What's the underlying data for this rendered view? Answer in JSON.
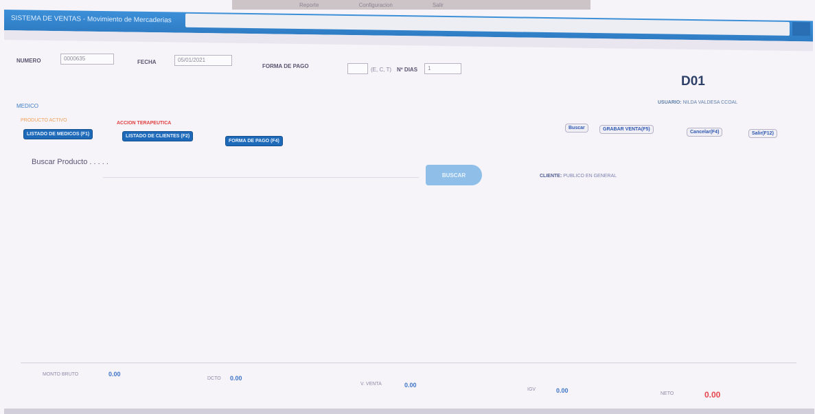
{
  "top_menu": [
    "",
    "Reporte",
    "Configuracion",
    "Salir"
  ],
  "window": {
    "title": "SISTEMA DE VENTAS - Movimiento de Mercaderias"
  },
  "form": {
    "numero_label": "NUMERO",
    "numero_value": "0000635",
    "fecha_label": "FECHA",
    "fecha_value": "05/01/2021",
    "forma_pago_label": "FORMA DE PAGO",
    "forma_pago_hint": "(E, C, T)",
    "dias_label": "Nº DIAS",
    "dias_value": "1"
  },
  "header": {
    "code": "D01",
    "usuario_label": "USUARIO:",
    "usuario_value": "NILDA VALDESA CCOAL"
  },
  "medico_label": "MEDICO",
  "tags": {
    "producto_activo": "PRODUCTO ACTIVO",
    "accion": "ACCION TERAPEUTICA"
  },
  "buttons": {
    "listado_medicos": "LISTADO DE MEDICOS (F1)",
    "listado_clientes": "LISTADO DE CLIENTES (F2)",
    "forma_pago": "FORMA DE PAGO (F4)",
    "buscar": "Buscar",
    "grabar": "GRABAR VENTA(F5)",
    "cancelar": "Cancelar(F4)",
    "salir": "Salir(F12)",
    "buscar_big": "BUSCAR"
  },
  "search": {
    "label": "Buscar Producto . . . . ."
  },
  "cliente": {
    "label": "CLIENTE:",
    "value": "PUBLICO EN GENERAL"
  },
  "totals": {
    "monto_bruto_label": "MONTO BRUTO",
    "monto_bruto_value": "0.00",
    "dcto_label": "DCTO",
    "dcto_value": "0.00",
    "venta_label": "V. VENTA",
    "venta_value": "0.00",
    "igv_label": "IGV",
    "igv_value": "0.00",
    "neto_label": "NETO",
    "neto_value": "0.00"
  },
  "colors": {
    "title_blue": "#2e7cc4",
    "button_blue": "#1f6ab8",
    "neto_red": "#e7454c"
  }
}
